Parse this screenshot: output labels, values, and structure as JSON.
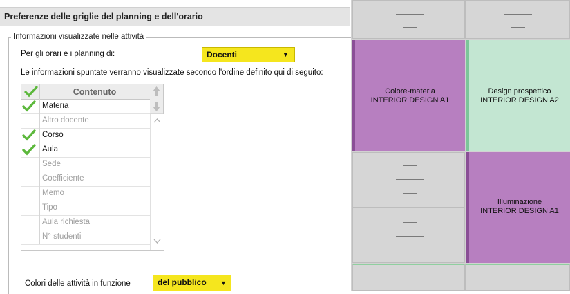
{
  "dialog": {
    "title": "Preferenze delle griglie del planning e dell'orario",
    "group_title": "Informazioni visualizzate nelle attività",
    "for_label": "Per gli orari e i planning di:",
    "for_value": "Docenti",
    "order_text": "Le informazioni spuntate verranno visualizzate secondo l'ordine definito qui di seguito:",
    "column_header": "Contenuto",
    "items": [
      {
        "label": "Materia",
        "checked": true
      },
      {
        "label": "Altro docente",
        "checked": false
      },
      {
        "label": "Corso",
        "checked": true
      },
      {
        "label": "Aula",
        "checked": true
      },
      {
        "label": "Sede",
        "checked": false
      },
      {
        "label": "Coefficiente",
        "checked": false
      },
      {
        "label": "Memo",
        "checked": false
      },
      {
        "label": "Tipo",
        "checked": false
      },
      {
        "label": "Aula richiesta",
        "checked": false
      },
      {
        "label": "N° studenti",
        "checked": false
      }
    ],
    "colors_label": "Colori delle attività in funzione",
    "colors_value": "del pubblico"
  },
  "timetable": {
    "events": [
      {
        "line1": "Colore-materia",
        "line2": "INTERIOR DESIGN A1",
        "color": "#b77fc0",
        "border": "#8a4f96"
      },
      {
        "line1": "Design prospettico",
        "line2": "INTERIOR DESIGN A2",
        "color": "#c3e6d2",
        "border": "#7cc69a"
      },
      {
        "line1": "Illuminazione",
        "line2": "INTERIOR DESIGN A1",
        "color": "#b77fc0",
        "border": "#8a4f96"
      }
    ]
  },
  "colors": {
    "accent_yellow": "#f5e61e",
    "check_green": "#5cb83c"
  }
}
